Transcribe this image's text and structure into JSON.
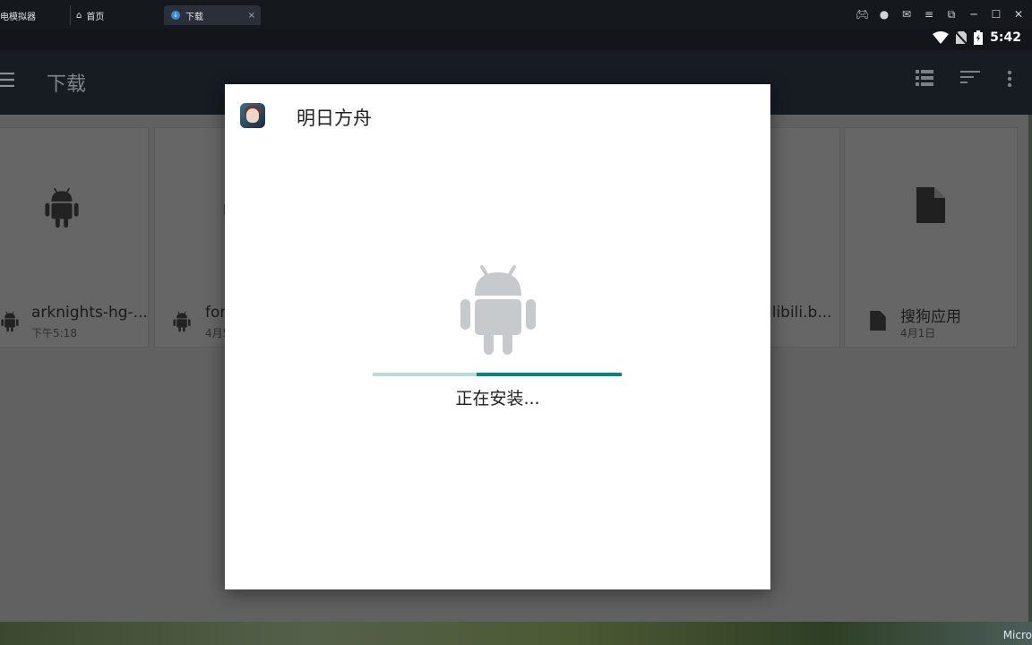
{
  "emulator": {
    "app_tab_label": "电模拟器",
    "home_tab_label": "首页",
    "active_tab_label": "下载",
    "close_glyph": "×",
    "controls": [
      "gamepad-icon",
      "user-icon",
      "mail-icon",
      "menu-icon",
      "restore-icon",
      "minimize-icon",
      "maximize-icon",
      "close-icon"
    ]
  },
  "status_bar": {
    "time": "5:42",
    "icons": [
      "wifi-icon",
      "no-sim-icon",
      "battery-charging-icon"
    ]
  },
  "toolbar": {
    "title": "下载",
    "actions": [
      "list-view-icon",
      "sort-icon",
      "more-vert-icon"
    ]
  },
  "files": [
    {
      "name": "arknights-hg-...",
      "date": "下午5:18",
      "icon": "android-icon"
    },
    {
      "name": "for",
      "date": "4月5",
      "icon": "android-icon"
    },
    {
      "name": "ilibili.b...",
      "date": "",
      "icon": "android-icon"
    },
    {
      "name": "搜狗应用",
      "date": "4月1日",
      "icon": "file-icon"
    }
  ],
  "dialog": {
    "title": "明日方舟",
    "status": "正在安装...",
    "progress_indeterminate": true
  },
  "desktop": {
    "corner_text": "Micro"
  },
  "colors": {
    "accent": "#00897b",
    "accent_light": "#b2dfdb",
    "toolbar_bg": "#161c22",
    "scrim_bg": "#616161"
  }
}
